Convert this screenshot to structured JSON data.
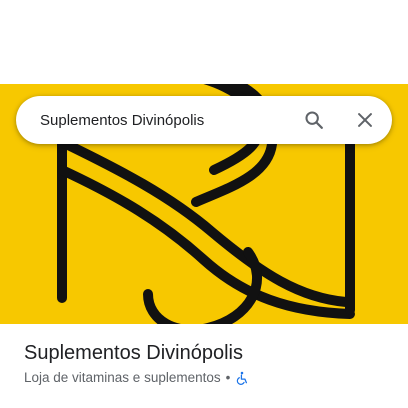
{
  "search": {
    "value": "Suplementos Divinópolis",
    "search_icon": "search-icon",
    "close_icon": "close-icon"
  },
  "hero": {
    "logo": "ns-monogram-logo",
    "background_color": "#f7c800",
    "stroke_color": "#111111"
  },
  "place": {
    "name": "Suplementos Divinópolis",
    "category": "Loja de vitaminas e suplementos",
    "separator": "•",
    "accessibility_icon": "wheelchair-accessible-icon",
    "accessibility_icon_color": "#1a73e8"
  }
}
